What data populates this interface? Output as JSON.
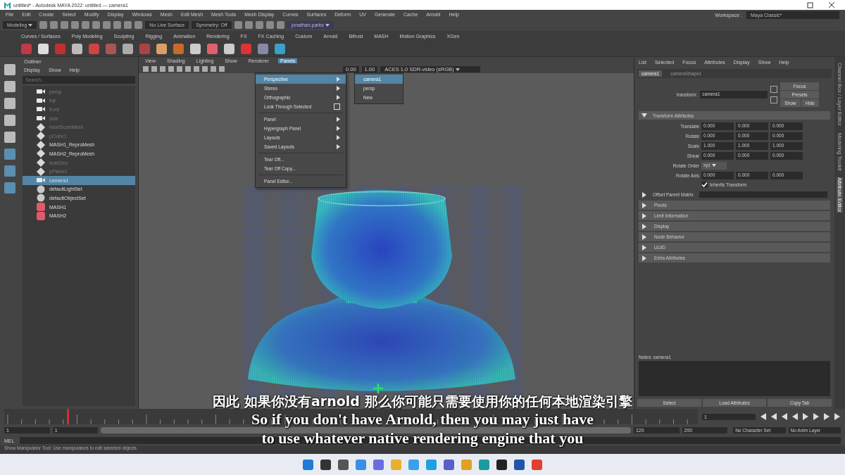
{
  "window": {
    "title": "untitled* - Autodesk MAYA 2022: untitled   ---   camera1"
  },
  "main_menu": [
    "File",
    "Edit",
    "Create",
    "Select",
    "Modify",
    "Display",
    "Windows",
    "Mesh",
    "Edit Mesh",
    "Mesh Tools",
    "Mesh Display",
    "Curves",
    "Surfaces",
    "Deform",
    "UV",
    "Generate",
    "Cache",
    "Arnold",
    "Help"
  ],
  "status_line": {
    "mode": "Modeling",
    "live_surface": "No Live Surface",
    "symmetry": "Symmetry: Off",
    "user": "jonathan.parks",
    "workspace_label": "Workspace :",
    "workspace": "Maya Classic*"
  },
  "shelf_tabs": [
    "Curves / Surfaces",
    "Poly Modeling",
    "Sculpting",
    "Rigging",
    "Animation",
    "Rendering",
    "FX",
    "FX Caching",
    "Custom",
    "Arnold",
    "Bifrost",
    "MASH",
    "Motion Graphics",
    "XGen"
  ],
  "outliner": {
    "title": "Outliner",
    "menu": [
      "Display",
      "Show",
      "Help"
    ],
    "search": {
      "placeholder": "Search..."
    },
    "items": [
      {
        "name": "persp",
        "kind": "camera",
        "hidden": true,
        "selected": false
      },
      {
        "name": "top",
        "kind": "camera",
        "hidden": true,
        "selected": false
      },
      {
        "name": "front",
        "kind": "camera",
        "hidden": true,
        "selected": false
      },
      {
        "name": "side",
        "kind": "camera",
        "hidden": true,
        "selected": false
      },
      {
        "name": "headScanMesh",
        "kind": "mesh",
        "hidden": true,
        "selected": false
      },
      {
        "name": "pCube1",
        "kind": "mesh",
        "hidden": true,
        "selected": false
      },
      {
        "name": "MASH1_ReproMesh",
        "kind": "mesh",
        "hidden": false,
        "selected": false
      },
      {
        "name": "MASH2_ReproMesh",
        "kind": "mesh",
        "hidden": false,
        "selected": false
      },
      {
        "name": "bustGeo",
        "kind": "mesh",
        "hidden": true,
        "selected": false
      },
      {
        "name": "pPlane1",
        "kind": "mesh",
        "hidden": true,
        "selected": false
      },
      {
        "name": "camera1",
        "kind": "camera",
        "hidden": false,
        "selected": true
      },
      {
        "name": "defaultLightSet",
        "kind": "set",
        "hidden": false,
        "selected": false
      },
      {
        "name": "defaultObjectSet",
        "kind": "set",
        "hidden": false,
        "selected": false
      },
      {
        "name": "MASH1",
        "kind": "mash",
        "hidden": false,
        "selected": false
      },
      {
        "name": "MASH2",
        "kind": "mash",
        "hidden": false,
        "selected": false
      }
    ]
  },
  "viewport": {
    "menu": [
      {
        "label": "View",
        "selected": false
      },
      {
        "label": "Shading",
        "selected": false
      },
      {
        "label": "Lighting",
        "selected": false
      },
      {
        "label": "Show",
        "selected": false
      },
      {
        "label": "Renderer",
        "selected": false
      },
      {
        "label": "Panels",
        "selected": true
      }
    ],
    "exposure": "0.00",
    "gamma": "1.00",
    "color_space": "ACES 1.0 SDR-video (sRGB)",
    "panels_menu": [
      [
        {
          "label": "Perspective",
          "kind": "submenu",
          "selected": true
        },
        {
          "label": "Stereo",
          "kind": "submenu",
          "selected": false
        },
        {
          "label": "Orthographic",
          "kind": "submenu",
          "selected": false
        },
        {
          "label": "Look Through Selected",
          "kind": "option",
          "selected": false
        }
      ],
      [
        {
          "label": "Panel",
          "kind": "submenu",
          "selected": false
        },
        {
          "label": "Hypergraph Panel",
          "kind": "submenu",
          "selected": false
        },
        {
          "label": "Layouts",
          "kind": "submenu",
          "selected": false
        },
        {
          "label": "Saved Layouts",
          "kind": "submenu",
          "selected": false
        }
      ],
      [
        {
          "label": "Tear Off...",
          "kind": "item",
          "selected": false
        },
        {
          "label": "Tear Off Copy...",
          "kind": "item",
          "selected": false
        }
      ],
      [
        {
          "label": "Panel Editor...",
          "kind": "item",
          "selected": false
        }
      ]
    ],
    "perspective_submenu": [
      {
        "label": "camera1",
        "selected": true
      },
      {
        "label": "persp",
        "selected": false
      },
      {
        "label": "New",
        "selected": false
      }
    ]
  },
  "attribute_editor": {
    "menu": [
      "List",
      "Selected",
      "Focus",
      "Attributes",
      "Display",
      "Show",
      "Help"
    ],
    "tabs": [
      {
        "label": "camera1",
        "selected": true
      },
      {
        "label": "cameraShape1",
        "selected": false
      }
    ],
    "node_label": "transform:",
    "node_name": "camera1",
    "buttons": [
      "Focus",
      "Presets"
    ],
    "show": "Show",
    "hide": "Hide",
    "section": {
      "label": "Transform Attributes",
      "expanded": true
    },
    "rows": [
      {
        "label": "Translate",
        "values": [
          "0.000",
          "0.000",
          "0.000"
        ]
      },
      {
        "label": "Rotate",
        "values": [
          "0.000",
          "0.000",
          "0.000"
        ]
      },
      {
        "label": "Scale",
        "values": [
          "1.000",
          "1.000",
          "1.000"
        ]
      },
      {
        "label": "Shear",
        "values": [
          "0.000",
          "0.000",
          "0.000"
        ]
      }
    ],
    "rotate_order": {
      "label": "Rotate Order",
      "value": "xyz"
    },
    "rotate_axis": {
      "label": "Rotate Axis",
      "values": [
        "0.000",
        "0.000",
        "0.000"
      ]
    },
    "inherits": {
      "label": "Inherits Transform",
      "checked": true
    },
    "offset_parent": {
      "label": "Offset Parent Matrix",
      "expanded": false
    },
    "collapsed_sections": [
      {
        "label": "Pivots",
        "expanded": false
      },
      {
        "label": "Limit Information",
        "expanded": false
      },
      {
        "label": "Display",
        "expanded": false
      },
      {
        "label": "Node Behavior",
        "expanded": false
      },
      {
        "label": "UUID",
        "expanded": false
      },
      {
        "label": "Extra Attributes",
        "expanded": false
      }
    ],
    "notes": "Notes:  camera1",
    "bottom_buttons": [
      "Select",
      "Load Attributes",
      "Copy Tab"
    ]
  },
  "side_tabs": [
    {
      "label": "Channel Box / Layer Editor",
      "selected": false
    },
    {
      "label": "Modeling Toolkit",
      "selected": false
    },
    {
      "label": "Attribute Editor",
      "selected": true
    }
  ],
  "time_slider": {
    "current_frame": "1",
    "level": 0.09
  },
  "range": {
    "level": 1,
    "start": "1",
    "playback_start": "1",
    "playback_end": "120",
    "end": "200",
    "character_set": "No Character Set",
    "anim_layer": "No Anim Layer"
  },
  "command_line": {
    "label": "MEL"
  },
  "help_line": "Show Manipulator Tool: Use manipulators to edit selected objects.",
  "subtitles": [
    "因此 如果你没有arnold 那么你可能只需要使用你的任何本地渲染引擎",
    "So if you don't have Arnold, then you may just have",
    "to use whatever native rendering engine that you"
  ]
}
